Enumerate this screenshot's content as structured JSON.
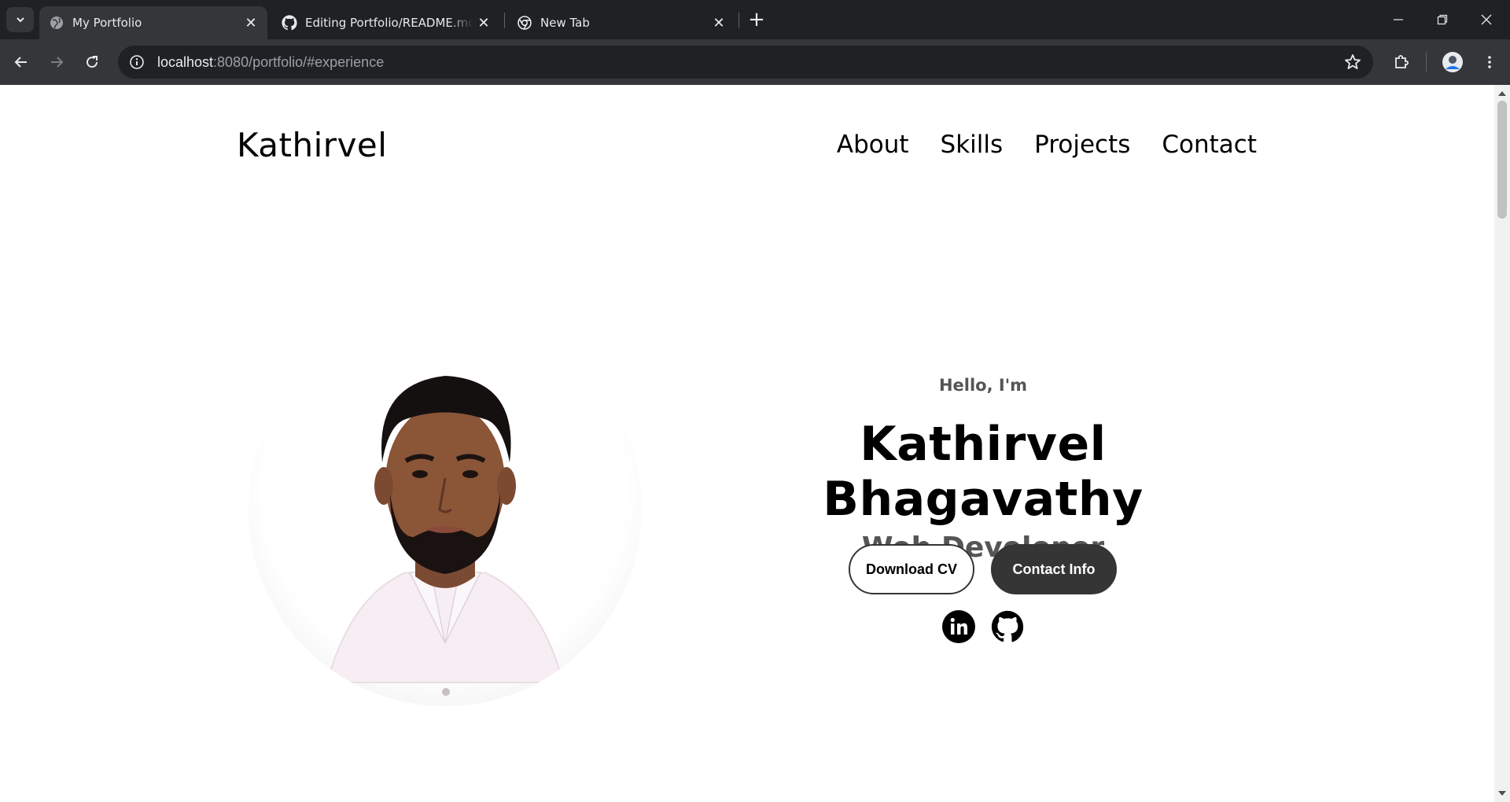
{
  "browser": {
    "tabs": [
      {
        "title": "My Portfolio",
        "active": true,
        "favicon": "globe-icon"
      },
      {
        "title": "Editing Portfolio/README.md at",
        "active": false,
        "favicon": "github-icon"
      },
      {
        "title": "New Tab",
        "active": false,
        "favicon": "chrome-icon"
      }
    ],
    "url_host": "localhost",
    "url_rest": ":8080/portfolio/#experience"
  },
  "page": {
    "logo": "Kathirvel",
    "nav": [
      "About",
      "Skills",
      "Projects",
      "Contact"
    ],
    "greeting": "Hello, I'm",
    "name": "Kathirvel Bhagavathy",
    "role": "Web Developer",
    "buttons": {
      "download": "Download CV",
      "contact": "Contact Info"
    },
    "socials": [
      "linkedin-icon",
      "github-icon"
    ]
  },
  "colors": {
    "chrome_dark": "#202124",
    "chrome_toolbar": "#35363a",
    "button_dark": "#353535",
    "text_muted": "#555555"
  }
}
